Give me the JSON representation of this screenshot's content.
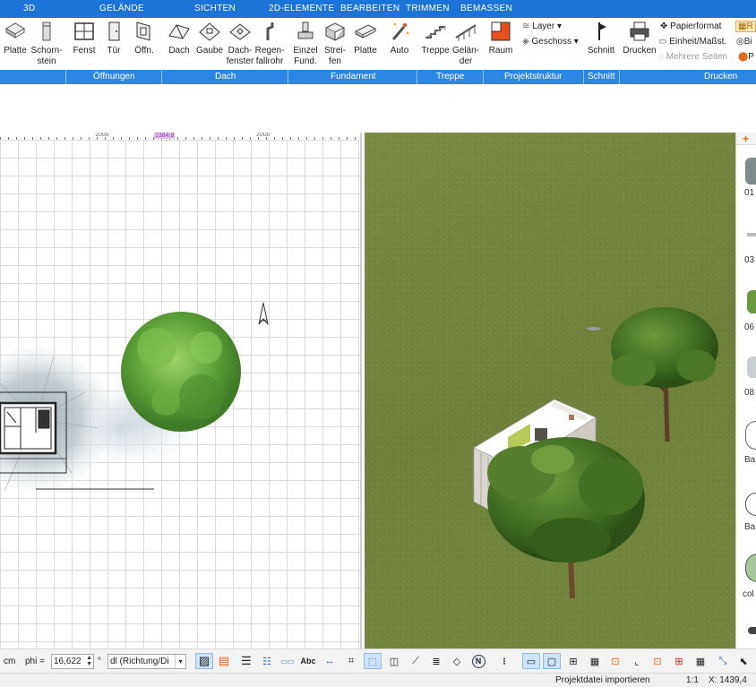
{
  "ribbon_tabs": [
    "3D",
    "GELÄNDE",
    "SICHTEN",
    "2D-ELEMENTE",
    "BEARBEITEN",
    "TRIMMEN",
    "BEMASSEN"
  ],
  "ribbon": {
    "buttons": {
      "platte_a": "Platte",
      "schornstein_1": "Schorn-",
      "schornstein_2": "stein",
      "fenster": "Fenst",
      "tuer": "Tür",
      "oeffnung": "Öffn.",
      "dach": "Dach",
      "gaube": "Gaube",
      "dachfenster_1": "Dach-",
      "dachfenster_2": "fenster",
      "regenfallrohr_1": "Regen-",
      "regenfallrohr_2": "fallrohr",
      "einzelfund_1": "Einzel",
      "einzelfund_2": "Fund.",
      "streifen_1": "Strei-",
      "streifen_2": "fen",
      "platte_b": "Platte",
      "auto": "Auto",
      "treppe": "Treppe",
      "gelaender_1": "Gelän-",
      "gelaender_2": "der",
      "raum": "Raum",
      "schnitt": "Schnitt",
      "drucken": "Drucken"
    },
    "small": {
      "layer": "Layer",
      "geschoss": "Geschoss",
      "papierformat": "Papierformat",
      "einheit": "Einheit/Maßst.",
      "mehrere_seiten": "Mehrere Seiten",
      "r_cut": "R",
      "b_cut": "Bi",
      "p_cut": "P"
    },
    "groups": {
      "oeffnungen": "Öffnungen",
      "dach": "Dach",
      "fundament": "Fundament",
      "treppe": "Treppe",
      "projektstruktur": "Projektstruktur",
      "schnitt": "Schnitt",
      "drucken": "Drucken"
    }
  },
  "plan": {
    "ruler_marks": [
      "1000",
      "2000"
    ],
    "ruler_selection": "1384.8"
  },
  "catalog": {
    "labels": [
      "01",
      "03",
      "06",
      "08",
      "Ba",
      "Ba",
      "col"
    ]
  },
  "toolbar": {
    "unit": "cm",
    "phi_label": "phi =",
    "phi_value": "16,622",
    "degree": "°",
    "direction": "dl (Richtung/Di",
    "text_tool": "Abc",
    "north": "N"
  },
  "status": {
    "message": "Projektdatei importieren",
    "scale": "1:1",
    "coords": "X: 1439,4"
  },
  "colors": {
    "ribbon_tab_bg": "#1e73d7",
    "group_bar_bg": "#2d86e3",
    "grass": "#74853e",
    "tree_green": "#4f8a2a"
  }
}
